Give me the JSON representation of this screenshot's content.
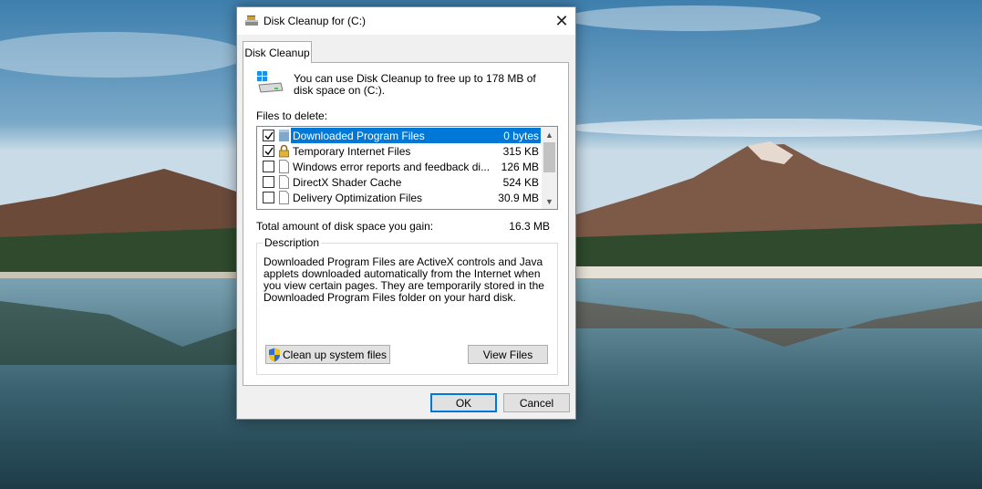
{
  "window": {
    "title": "Disk Cleanup for  (C:)",
    "close_glyph": "✕",
    "icon": "disk-cleanup-icon"
  },
  "tab": {
    "label": "Disk Cleanup"
  },
  "intro": {
    "text": "You can use Disk Cleanup to free up to 178 MB of disk space on  (C:).",
    "icon": "drive-icon"
  },
  "files_label": "Files to delete:",
  "files": [
    {
      "name": "Downloaded Program Files",
      "size": "0 bytes",
      "checked": true,
      "selected": true,
      "icon": "folder-icon"
    },
    {
      "name": "Temporary Internet Files",
      "size": "315 KB",
      "checked": true,
      "selected": false,
      "icon": "lock-icon"
    },
    {
      "name": "Windows error reports and feedback di...",
      "size": "126 MB",
      "checked": false,
      "selected": false,
      "icon": "file-icon"
    },
    {
      "name": "DirectX Shader Cache",
      "size": "524 KB",
      "checked": false,
      "selected": false,
      "icon": "file-icon"
    },
    {
      "name": "Delivery Optimization Files",
      "size": "30.9 MB",
      "checked": false,
      "selected": false,
      "icon": "file-icon"
    }
  ],
  "scrollbar": {
    "up_glyph": "▲",
    "down_glyph": "▼"
  },
  "total": {
    "label": "Total amount of disk space you gain:",
    "value": "16.3 MB"
  },
  "description": {
    "legend": "Description",
    "text": "Downloaded Program Files are ActiveX controls and Java applets downloaded automatically from the Internet when you view certain pages. They are temporarily stored in the Downloaded Program Files folder on your hard disk."
  },
  "buttons": {
    "cleanup_system": "Clean up system files",
    "view_files": "View Files",
    "ok": "OK",
    "cancel": "Cancel"
  },
  "colors": {
    "selection": "#0078d7",
    "dialog_bg": "#f0f0f0",
    "button_bg": "#e1e1e1"
  }
}
